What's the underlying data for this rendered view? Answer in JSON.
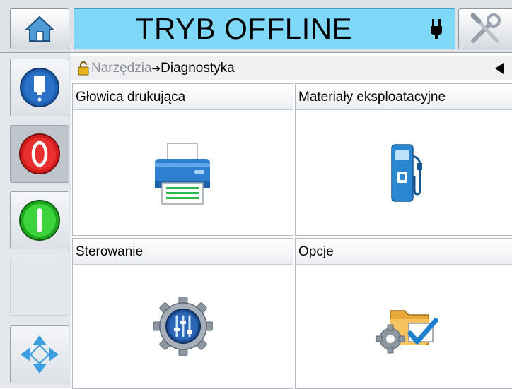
{
  "header": {
    "status_title": "TRYB OFFLINE",
    "status_color": "#7fd8f7",
    "icons": [
      "home-icon",
      "plug-icon",
      "tools-icon"
    ]
  },
  "sidebar": {
    "buttons": [
      {
        "name": "ink-drop-button",
        "icon": "ink-cartridge-icon"
      },
      {
        "name": "stop-button",
        "icon": "stop-icon",
        "color": "#e02020"
      },
      {
        "name": "start-button",
        "icon": "start-icon",
        "color": "#28c828"
      },
      {
        "name": "navigation-button",
        "icon": "four-way-arrow-icon"
      }
    ]
  },
  "breadcrumb": {
    "parent": "Narzędzia",
    "separator": "➔",
    "current": "Diagnostyka"
  },
  "tiles": [
    {
      "label": "Głowica drukująca",
      "icon": "printer-icon"
    },
    {
      "label": "Materiały eksploatacyjne",
      "icon": "fuel-pump-icon"
    },
    {
      "label": "Sterowanie",
      "icon": "gear-controls-icon"
    },
    {
      "label": "Opcje",
      "icon": "folder-options-icon"
    }
  ]
}
